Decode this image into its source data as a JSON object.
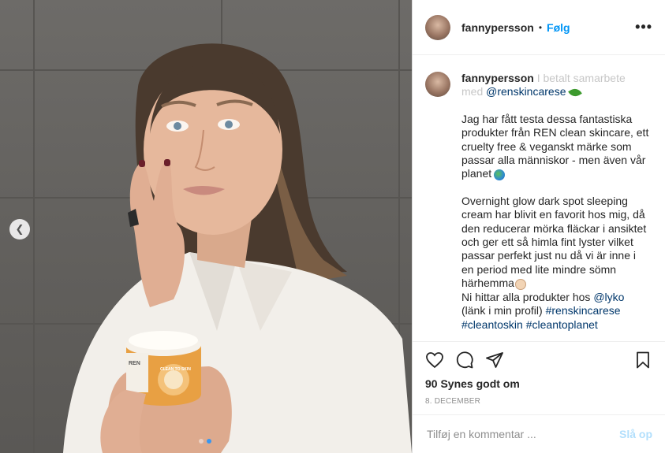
{
  "post": {
    "username": "fannypersson",
    "follow_label": "Følg",
    "more_label": "•••"
  },
  "caption": {
    "username": "fannypersson",
    "partner_text": "I betalt samarbete med",
    "partner_mention": "@renskincarese",
    "paragraph1": "Jag har fått testa dessa fantastiska produkter från REN clean skincare, ett cruelty free & veganskt märke som passar alla människor - men även vår planet",
    "paragraph2": "Overnight glow dark spot sleeping cream har blivit en favorit hos mig, då den reducerar mörka fläckar i ansiktet och ger ett så himla fint lyster vilket passar perfekt just nu då vi är inne i en period med lite mindre sömn härhemma",
    "paragraph3_prefix": "Ni hittar alla produkter hos",
    "paragraph3_mention": "@lyko",
    "paragraph3_suffix": "(länk i min profil)",
    "hashtags": [
      "#renskincarese",
      "#cleantoskin",
      "#cleantoplanet"
    ]
  },
  "photo": {
    "jar_brand": "REN",
    "jar_label": "CLEAN TO SKIN",
    "carousel_total": 2,
    "carousel_active": 2
  },
  "likes": "90 Synes godt om",
  "date": "8. DECEMBER",
  "comment": {
    "placeholder": "Tilføj en kommentar ...",
    "post_label": "Slå op"
  },
  "icons": {
    "like": "heart-icon",
    "comment": "comment-bubble-icon",
    "share": "paper-plane-icon",
    "save": "bookmark-icon",
    "prev": "chevron-left-icon"
  },
  "colors": {
    "link_blue": "#0095f6",
    "mention_blue": "#00376b",
    "post_disabled": "#b2dffc",
    "jar_orange": "#e8a043"
  }
}
